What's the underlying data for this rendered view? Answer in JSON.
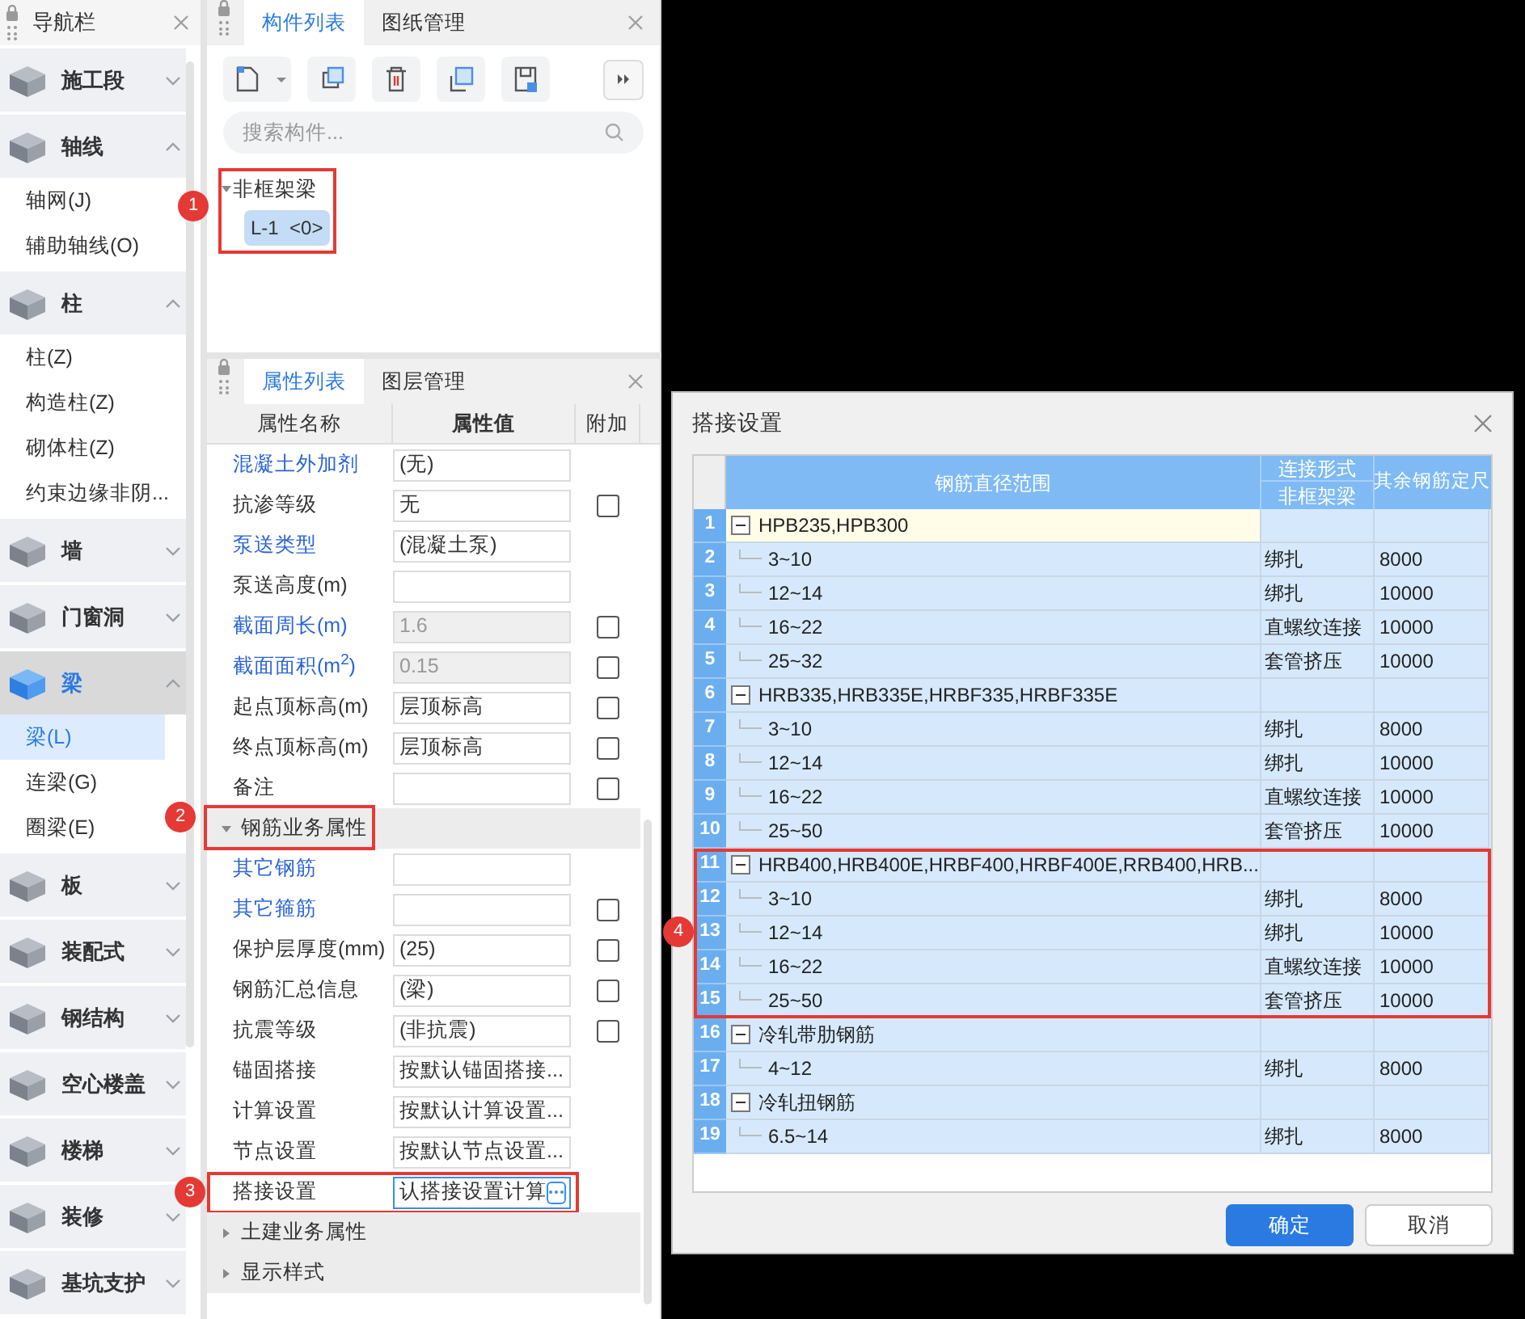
{
  "nav": {
    "title": "导航栏",
    "groups": [
      {
        "label": "施工段",
        "expanded": false,
        "selected": false
      },
      {
        "label": "轴线",
        "expanded": true,
        "selected": false,
        "children": [
          {
            "label": "轴网(J)",
            "selected": false
          },
          {
            "label": "辅助轴线(O)",
            "selected": false
          }
        ]
      },
      {
        "label": "柱",
        "expanded": true,
        "selected": false,
        "children": [
          {
            "label": "柱(Z)",
            "selected": false
          },
          {
            "label": "构造柱(Z)",
            "selected": false
          },
          {
            "label": "砌体柱(Z)",
            "selected": false
          },
          {
            "label": "约束边缘非阴...",
            "selected": false
          }
        ]
      },
      {
        "label": "墙",
        "expanded": false,
        "selected": false
      },
      {
        "label": "门窗洞",
        "expanded": false,
        "selected": false
      },
      {
        "label": "梁",
        "expanded": true,
        "selected": true,
        "children": [
          {
            "label": "梁(L)",
            "selected": true
          },
          {
            "label": "连梁(G)",
            "selected": false
          },
          {
            "label": "圈梁(E)",
            "selected": false
          }
        ]
      },
      {
        "label": "板",
        "expanded": false,
        "selected": false
      },
      {
        "label": "装配式",
        "expanded": false,
        "selected": false
      },
      {
        "label": "钢结构",
        "expanded": false,
        "selected": false
      },
      {
        "label": "空心楼盖",
        "expanded": false,
        "selected": false
      },
      {
        "label": "楼梯",
        "expanded": false,
        "selected": false
      },
      {
        "label": "装修",
        "expanded": false,
        "selected": false
      },
      {
        "label": "基坑支护",
        "expanded": false,
        "selected": false
      }
    ]
  },
  "components": {
    "tabs": [
      {
        "label": "构件列表",
        "selected": true
      },
      {
        "label": "图纸管理",
        "selected": false
      }
    ],
    "search": {
      "placeholder": "搜索构件..."
    },
    "tree": {
      "label": "非框架梁",
      "expanded": true,
      "callout": "1",
      "children": [
        {
          "label": "L-1  <0>",
          "selected": true
        }
      ]
    }
  },
  "properties": {
    "tabs": [
      {
        "label": "属性列表",
        "selected": true
      },
      {
        "label": "图层管理",
        "selected": false
      }
    ],
    "columns": [
      "属性名称",
      "属性值",
      "附加"
    ],
    "rows": [
      {
        "kind": "property",
        "name": "混凝土外加剂",
        "highlighted": true,
        "value": "(无)",
        "disabled": false
      },
      {
        "kind": "property",
        "name": "抗渗等级",
        "highlighted": false,
        "value": "无",
        "disabled": false,
        "checked": false
      },
      {
        "kind": "property",
        "name": "泵送类型",
        "highlighted": true,
        "value": "(混凝土泵)",
        "disabled": false
      },
      {
        "kind": "property",
        "name": "泵送高度(m)",
        "highlighted": false,
        "disabled": false
      },
      {
        "kind": "property",
        "name": "截面周长(m)",
        "highlighted": true,
        "value": "1.6",
        "disabled": true,
        "checked": false
      },
      {
        "kind": "property",
        "name": "截面面积(m$^{2}$)",
        "highlighted": true,
        "value": "0.15",
        "disabled": true,
        "checked": false
      },
      {
        "kind": "property",
        "name": "起点顶标高(m)",
        "highlighted": false,
        "value": "层顶标高",
        "disabled": false,
        "checked": false
      },
      {
        "kind": "property",
        "name": "终点顶标高(m)",
        "highlighted": false,
        "value": "层顶标高",
        "disabled": false,
        "checked": false
      },
      {
        "kind": "property",
        "name": "备注",
        "highlighted": false,
        "disabled": false,
        "checked": false
      },
      {
        "kind": "section",
        "name": "钢筋业务属性",
        "expanded": true,
        "callout": "2"
      },
      {
        "kind": "property",
        "name": "其它钢筋",
        "highlighted": true,
        "disabled": false
      },
      {
        "kind": "property",
        "name": "其它箍筋",
        "highlighted": true,
        "disabled": false,
        "checked": false
      },
      {
        "kind": "property",
        "name": "保护层厚度(mm)",
        "highlighted": false,
        "value": "(25)",
        "disabled": false,
        "checked": false
      },
      {
        "kind": "property",
        "name": "钢筋汇总信息",
        "highlighted": false,
        "value": "(梁)",
        "disabled": false,
        "checked": false
      },
      {
        "kind": "property",
        "name": "抗震等级",
        "highlighted": false,
        "value": "(非抗震)",
        "disabled": false,
        "checked": false
      },
      {
        "kind": "property",
        "name": "锚固搭接",
        "highlighted": false,
        "value": "按默认锚固搭接...",
        "disabled": false
      },
      {
        "kind": "property",
        "name": "计算设置",
        "highlighted": false,
        "value": "按默认计算设置...",
        "disabled": false
      },
      {
        "kind": "property",
        "name": "节点设置",
        "highlighted": false,
        "value": "按默认节点设置...",
        "disabled": false
      },
      {
        "kind": "property",
        "name": "搭接设置",
        "highlighted": false,
        "value": "认搭接设置计算",
        "disabled": false,
        "focused": true,
        "callout": "3"
      },
      {
        "kind": "section",
        "name": "土建业务属性",
        "expanded": false
      },
      {
        "kind": "section",
        "name": "显示样式",
        "expanded": false
      }
    ]
  },
  "dialog": {
    "title": "搭接设置",
    "columns": {
      "range": "钢筋直径范围",
      "connection_group": "连接形式",
      "connection": "非框架梁",
      "length": "其余钢筋定尺"
    },
    "groups": [
      {
        "number": "1",
        "label": "HPB235,HPB300",
        "expanded": true,
        "selected": true,
        "rows": [
          {
            "number": "2",
            "range": "3~10",
            "connection": "绑扎",
            "length": "8000"
          },
          {
            "number": "3",
            "range": "12~14",
            "connection": "绑扎",
            "length": "10000"
          },
          {
            "number": "4",
            "range": "16~22",
            "connection": "直螺纹连接",
            "length": "10000"
          },
          {
            "number": "5",
            "range": "25~32",
            "connection": "套管挤压",
            "length": "10000"
          }
        ]
      },
      {
        "number": "6",
        "label": "HRB335,HRB335E,HRBF335,HRBF335E",
        "expanded": true,
        "selected": false,
        "rows": [
          {
            "number": "7",
            "range": "3~10",
            "connection": "绑扎",
            "length": "8000"
          },
          {
            "number": "8",
            "range": "12~14",
            "connection": "绑扎",
            "length": "10000"
          },
          {
            "number": "9",
            "range": "16~22",
            "connection": "直螺纹连接",
            "length": "10000"
          },
          {
            "number": "10",
            "range": "25~50",
            "connection": "套管挤压",
            "length": "10000"
          }
        ]
      },
      {
        "number": "11",
        "label": "HRB400,HRB400E,HRBF400,HRBF400E,RRB400,HRB...",
        "expanded": true,
        "selected": false,
        "callout": "4",
        "rows": [
          {
            "number": "12",
            "range": "3~10",
            "connection": "绑扎",
            "length": "8000"
          },
          {
            "number": "13",
            "range": "12~14",
            "connection": "绑扎",
            "length": "10000"
          },
          {
            "number": "14",
            "range": "16~22",
            "connection": "直螺纹连接",
            "length": "10000"
          },
          {
            "number": "15",
            "range": "25~50",
            "connection": "套管挤压",
            "length": "10000"
          }
        ]
      },
      {
        "number": "16",
        "label": "冷轧带肋钢筋",
        "expanded": true,
        "selected": false,
        "rows": [
          {
            "number": "17",
            "range": "4~12",
            "connection": "绑扎",
            "length": "8000"
          }
        ]
      },
      {
        "number": "18",
        "label": "冷轧扭钢筋",
        "expanded": true,
        "selected": false,
        "rows": [
          {
            "number": "19",
            "range": "6.5~14",
            "connection": "绑扎",
            "length": "8000"
          }
        ]
      }
    ],
    "buttons": [
      {
        "label": "确定",
        "kind": "primary"
      },
      {
        "label": "取消",
        "kind": "secondary"
      }
    ]
  }
}
